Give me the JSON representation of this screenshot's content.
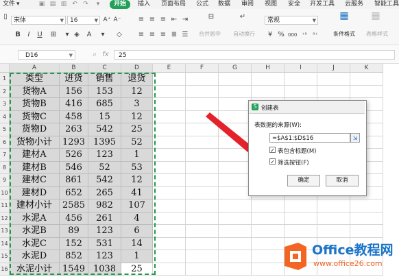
{
  "menubar": {
    "file": "文件",
    "tabs": [
      "开始",
      "插入",
      "页面布局",
      "公式",
      "数据",
      "审阅",
      "视图",
      "安全",
      "开发工具",
      "云服务",
      "智能工具"
    ],
    "active_tab": "开始"
  },
  "ribbon": {
    "font_name": "宋体",
    "font_size": "16",
    "number_format": "常规",
    "bold": "B",
    "italic": "I",
    "underline": "U",
    "font_grow": "A⁺",
    "font_shrink": "A⁻",
    "merge_label": "合并居中",
    "wrap_label": "自动换行",
    "conditional_label": "条件格式",
    "table_style_label": "表格样式",
    "currency": "¥",
    "percent": "%",
    "thousands": "000",
    "dec_inc": "⁺⁰",
    "dec_dec": "⁰⁺"
  },
  "formulabar": {
    "cell_ref": "D16",
    "fx": "fx",
    "value": "25"
  },
  "grid": {
    "columns": [
      "A",
      "B",
      "C",
      "D",
      "E",
      "F",
      "G",
      "H",
      "I",
      "J",
      "K"
    ],
    "rows": [
      "1",
      "2",
      "3",
      "4",
      "5",
      "6",
      "7",
      "8",
      "9",
      "10",
      "11",
      "12",
      "13",
      "14",
      "15",
      "16"
    ],
    "data": [
      [
        "类型",
        "进货",
        "销售",
        "退货"
      ],
      [
        "货物A",
        "156",
        "153",
        "12"
      ],
      [
        "货物B",
        "416",
        "685",
        "3"
      ],
      [
        "货物C",
        "458",
        "15",
        "12"
      ],
      [
        "货物D",
        "263",
        "542",
        "25"
      ],
      [
        "货物小计",
        "1293",
        "1395",
        "52"
      ],
      [
        "建材A",
        "526",
        "123",
        "1"
      ],
      [
        "建材B",
        "546",
        "52",
        "53"
      ],
      [
        "建材C",
        "861",
        "542",
        "12"
      ],
      [
        "建材D",
        "652",
        "265",
        "41"
      ],
      [
        "建材小计",
        "2585",
        "982",
        "107"
      ],
      [
        "水泥A",
        "456",
        "261",
        "4"
      ],
      [
        "水泥B",
        "89",
        "123",
        "6"
      ],
      [
        "水泥C",
        "152",
        "531",
        "14"
      ],
      [
        "水泥D",
        "852",
        "123",
        "1"
      ],
      [
        "水泥小计",
        "1549",
        "1038",
        "25"
      ]
    ]
  },
  "dialog": {
    "title": "创建表",
    "source_label": "表数据的来源(W):",
    "source_value": "=$A$1:$D$16",
    "has_header_label": "表包含标题(M)",
    "filter_label": "筛选按钮(F)",
    "has_header_checked": true,
    "filter_checked": true,
    "ok_label": "确定",
    "cancel_label": "取消",
    "check_mark": "✓"
  },
  "watermark": {
    "brand": "Office教程网",
    "url": "www.office26.com"
  },
  "colors": {
    "accent_green": "#22a05a",
    "selection_gray": "#d9d9d9",
    "arrow_red": "#e5212b",
    "logo_orange": "#f26522",
    "logo_blue": "#1a74c8"
  }
}
